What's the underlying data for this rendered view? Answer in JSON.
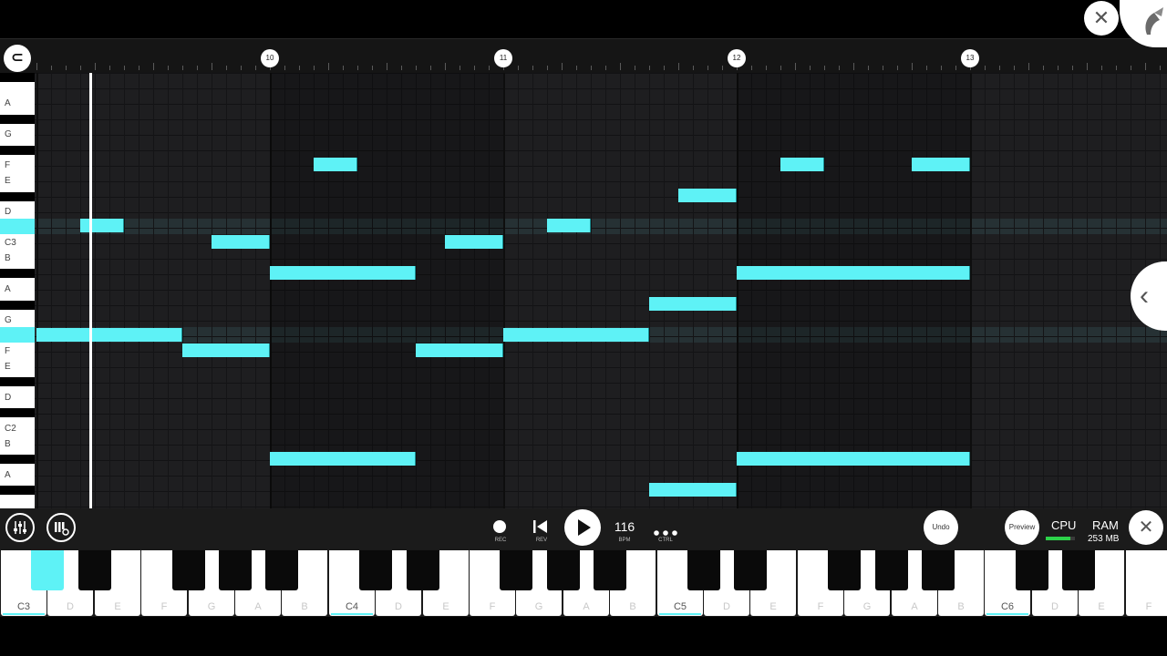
{
  "ruler": {
    "bar_markers": [
      "10",
      "11",
      "12",
      "13"
    ],
    "snap_icon": "magnet-icon",
    "close_icon": "close-icon",
    "logo_icon": "app-logo-icon"
  },
  "side_keys": {
    "labels": [
      "A",
      "G",
      "F",
      "E",
      "D",
      "C3",
      "B",
      "A",
      "G",
      "F",
      "E",
      "D",
      "C2",
      "B",
      "A"
    ]
  },
  "notes": {
    "accent_color": "#5ef2f6"
  },
  "transport": {
    "mixer_icon": "mixer-icon",
    "instrument_icon": "instrument-settings-icon",
    "rec_label": "REC",
    "rev_label": "REV",
    "bpm_value": "116",
    "bpm_label": "BPM",
    "ctrl_label": "CTRL",
    "undo_label": "Undo",
    "preview_label": "Preview",
    "cpu_label": "CPU",
    "cpu_level": 0.85,
    "cpu_meter_color": "#2dd24a",
    "ram_label": "RAM",
    "ram_value": "253 MB",
    "close_icon": "close-icon"
  },
  "piano": {
    "white_labels": [
      "C3",
      "D",
      "E",
      "F",
      "G",
      "A",
      "B",
      "C4",
      "D",
      "E",
      "F",
      "G",
      "A",
      "B",
      "C5",
      "D",
      "E",
      "F",
      "G",
      "A",
      "B",
      "C6",
      "D",
      "E",
      "F"
    ],
    "pressed_key": "C#3"
  }
}
